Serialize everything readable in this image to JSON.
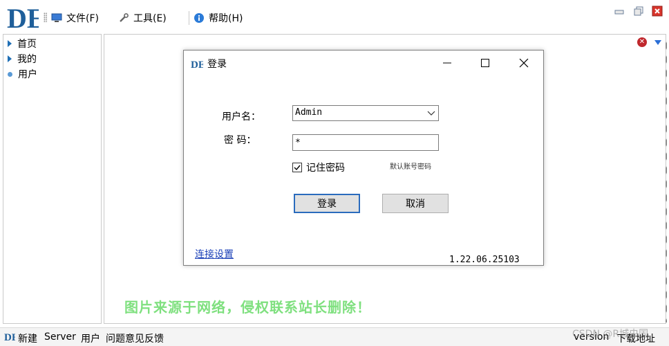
{
  "app": {
    "logo_text": "DE"
  },
  "menu": {
    "items": [
      {
        "label": "文件(F)",
        "icon": "monitor-icon"
      },
      {
        "label": "工具(E)",
        "icon": "wrench-icon"
      },
      {
        "label": "帮助(H)",
        "icon": "info-icon"
      }
    ]
  },
  "tree": {
    "items": [
      {
        "label": "首页"
      },
      {
        "label": "我的"
      },
      {
        "label": "用户"
      }
    ]
  },
  "dialog": {
    "title": "登录",
    "username_label": "用户名：",
    "password_label": "密 码：",
    "username_value": "Admin",
    "password_value": "*",
    "remember_label": "记住密码",
    "remember_checked": true,
    "default_account_hint": "默认账号密码",
    "login_button": "登录",
    "cancel_button": "取消",
    "connection_settings_link": "连接设置",
    "version": "1.22.06.25103"
  },
  "watermark": "图片来源于网络，侵权联系站长删除！",
  "statusbar": {
    "items": [
      "新建",
      "Server",
      "用户",
      "问题意见反馈"
    ],
    "right_items": [
      "version",
      "下载地址"
    ]
  },
  "csdn_watermark": "CSDN @R城虫国",
  "colors": {
    "accent": "#1f6fb5",
    "link": "#1a3fb7",
    "watermark": "#7fe07f"
  }
}
